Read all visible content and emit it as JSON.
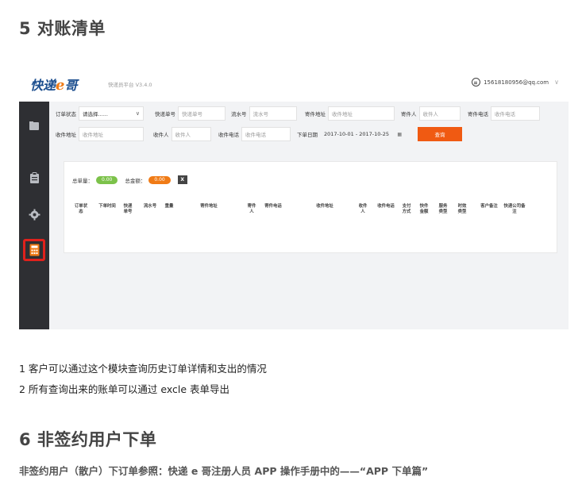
{
  "section5": {
    "title": "5 对账清单"
  },
  "app": {
    "logo_prefix": "快递",
    "logo_e": "e",
    "logo_suffix": "哥",
    "version": "快递员平台 V3.4.0",
    "user_email": "15618180956@qq.com",
    "sidebar_icons": [
      "folder-icon",
      "clipboard-icon",
      "gear-icon",
      "calculator-icon"
    ],
    "filters": {
      "order_status_label": "订单状态",
      "order_status_value": "请选择......",
      "express_no_label": "快递单号",
      "express_no_placeholder": "快递单号",
      "serial_no_label": "流水号",
      "serial_no_placeholder": "流水号",
      "sender_addr_label": "寄件地址",
      "sender_addr_placeholder": "收件地址",
      "sender_label": "寄件人",
      "sender_placeholder": "收件人",
      "sender_phone_label": "寄件电话",
      "sender_phone_placeholder": "收件电话",
      "recv_addr_label": "收件地址",
      "recv_addr_placeholder": "收件地址",
      "receiver_label": "收件人",
      "receiver_placeholder": "收件人",
      "recv_phone_label": "收件电话",
      "recv_phone_placeholder": "收件电话",
      "date_label": "下单日期",
      "date_value": "2017-10-01 - 2017-10-25",
      "query_button": "查询"
    },
    "totals": {
      "total_orders_label": "总单量：",
      "total_orders_value": "0.00",
      "total_amount_label": "总金额：",
      "total_amount_value": "0.00",
      "export_icon_text": "X"
    },
    "table_headers": [
      "订单状态",
      "下单时间",
      "快递单号",
      "流水号",
      "重量",
      "寄件地址",
      "寄件人",
      "寄件电话",
      "收件地址",
      "收件人",
      "收件电话",
      "支付方式",
      "快件金额",
      "服务类型",
      "时效类型",
      "客户备注",
      "快递公司备注"
    ]
  },
  "paragraphs": {
    "p1": "1 客户可以通过这个模块查询历史订单详情和支出的情况",
    "p2": "2 所有查询出来的账单可以通过 excle 表单导出"
  },
  "section6": {
    "title": "6 非签约用户下单",
    "subtitle": "非签约用户（散户）下订单参照：快递 e 哥注册人员 APP 操作手册中的——“APP 下单篇”"
  }
}
